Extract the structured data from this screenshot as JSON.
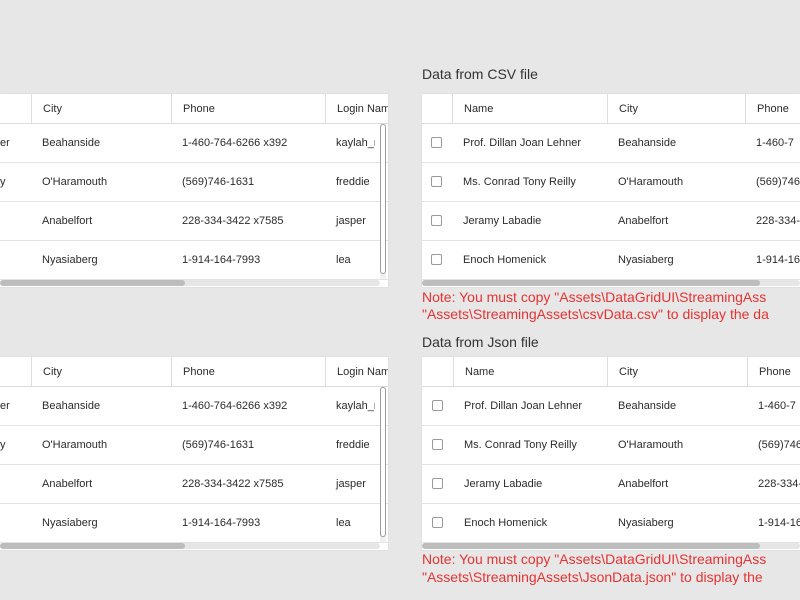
{
  "left_grid": {
    "headers": {
      "city": "City",
      "phone": "Phone",
      "login": "Login Nam"
    },
    "rows": [
      {
        "name_tail": "er",
        "city": "Beahanside",
        "phone": "1-460-764-6266 x392",
        "login": "kaylah_m"
      },
      {
        "name_tail": "y",
        "city": "O'Haramouth",
        "phone": "(569)746-1631",
        "login": "freddie"
      },
      {
        "name_tail": "",
        "city": "Anabelfort",
        "phone": "228-334-3422 x7585",
        "login": "jasper"
      },
      {
        "name_tail": "",
        "city": "Nyasiaberg",
        "phone": "1-914-164-7993",
        "login": "lea"
      }
    ]
  },
  "csv_section": {
    "title": "Data from CSV file",
    "headers": {
      "name": "Name",
      "city": "City",
      "phone": "Phone"
    },
    "rows": [
      {
        "name": "Prof. Dillan Joan Lehner",
        "city": "Beahanside",
        "phone": "1-460-7"
      },
      {
        "name": "Ms. Conrad Tony Reilly",
        "city": "O'Haramouth",
        "phone": "(569)746"
      },
      {
        "name": "Jeramy Labadie",
        "city": "Anabelfort",
        "phone": "228-334-"
      },
      {
        "name": "Enoch Homenick",
        "city": "Nyasiaberg",
        "phone": "1-914-16"
      }
    ],
    "note_line1": "Note: You must copy \"Assets\\DataGridUI\\StreamingAss",
    "note_line2": "\"Assets\\StreamingAssets\\csvData.csv\" to display the da"
  },
  "json_section": {
    "title": "Data from Json file",
    "headers": {
      "name": "Name",
      "city": "City",
      "phone": "Phone"
    },
    "rows": [
      {
        "name": "Prof. Dillan Joan Lehner",
        "city": "Beahanside",
        "phone": "1-460-7"
      },
      {
        "name": "Ms. Conrad Tony Reilly",
        "city": "O'Haramouth",
        "phone": "(569)746"
      },
      {
        "name": "Jeramy Labadie",
        "city": "Anabelfort",
        "phone": "228-334-"
      },
      {
        "name": "Enoch Homenick",
        "city": "Nyasiaberg",
        "phone": "1-914-16"
      }
    ],
    "note_line1": "Note: You must copy \"Assets\\DataGridUI\\StreamingAss",
    "note_line2": "\"Assets\\StreamingAssets\\JsonData.json\" to display the"
  },
  "colors": {
    "note_red": "#e53333",
    "background": "#e7e7e7"
  }
}
